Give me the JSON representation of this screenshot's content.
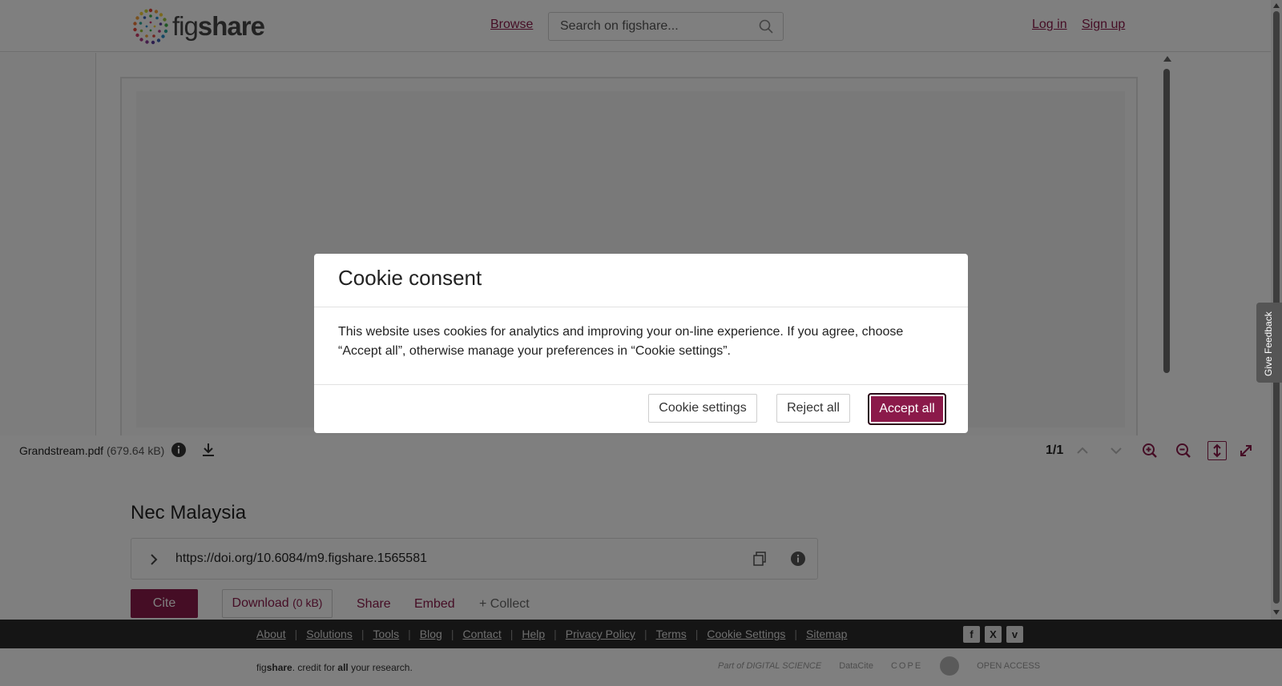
{
  "header": {
    "logo_text_light": "fig",
    "logo_text_bold": "share",
    "browse_label": "Browse",
    "search_placeholder": "Search on figshare...",
    "login_label": "Log in",
    "signup_label": "Sign up"
  },
  "viewer": {
    "file_name": "Grandstream.pdf",
    "file_size": "(679.64 kB)",
    "page_indicator": "1/1"
  },
  "item": {
    "title": "Nec Malaysia",
    "doi": "https://doi.org/10.6084/m9.figshare.1565581",
    "cite_label": "Cite",
    "download_label": "Download",
    "download_size": "(0 kB)",
    "share_label": "Share",
    "embed_label": "Embed",
    "collect_label": "+ Collect"
  },
  "footer": {
    "links": [
      "About",
      "Solutions",
      "Tools",
      "Blog",
      "Contact",
      "Help",
      "Privacy Policy",
      "Terms",
      "Cookie Settings",
      "Sitemap"
    ],
    "social": [
      "f",
      "X",
      "v"
    ],
    "tagline_pre": "fig",
    "tagline_bold": "share",
    "tagline_mid": ". credit for ",
    "tagline_all": "all",
    "tagline_post": " your research.",
    "partners": [
      "Part of DIGITAL SCIENCE",
      "DataCite",
      "COPE",
      "",
      "OPEN ACCESS"
    ]
  },
  "feedback": {
    "label": "Give Feedback"
  },
  "cookie_modal": {
    "title": "Cookie consent",
    "body": "This website uses cookies for analytics and improving your on-line experience. If you agree, choose “Accept all”, otherwise manage your preferences in “Cookie settings”.",
    "settings_label": "Cookie settings",
    "reject_label": "Reject all",
    "accept_label": "Accept all"
  },
  "colors": {
    "brand": "#8b1a4a",
    "footer_bg": "#2b2b2b",
    "overlay": "rgba(0,0,0,0.5)"
  }
}
